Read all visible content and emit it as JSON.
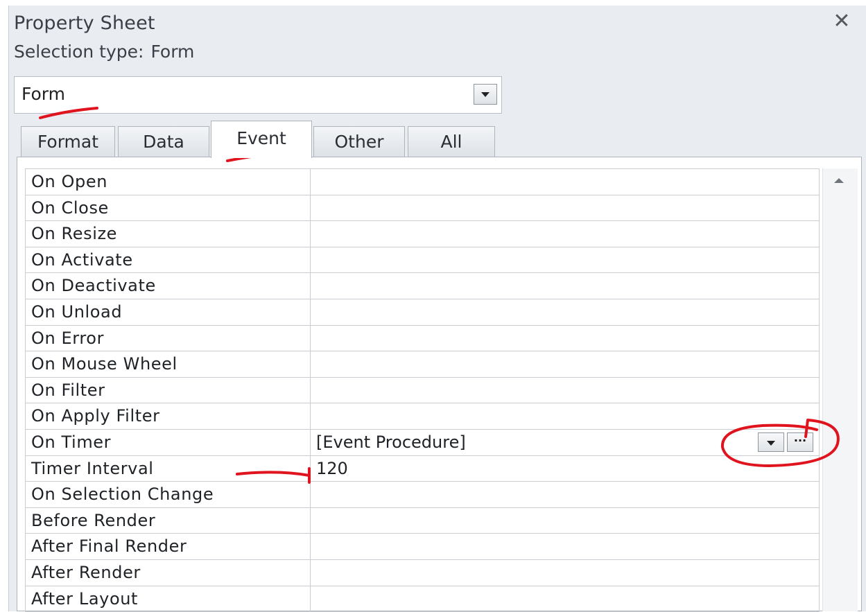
{
  "panel": {
    "title": "Property Sheet",
    "close_label": "✕",
    "selection_type_label": "Selection type:",
    "selection_type_value": "Form"
  },
  "object_selector": {
    "value": "Form"
  },
  "tabs": [
    {
      "label": "Format",
      "active": false
    },
    {
      "label": "Data",
      "active": false
    },
    {
      "label": "Event",
      "active": true
    },
    {
      "label": "Other",
      "active": false
    },
    {
      "label": "All",
      "active": false
    }
  ],
  "properties": [
    {
      "name": "On Open",
      "value": ""
    },
    {
      "name": "On Close",
      "value": ""
    },
    {
      "name": "On Resize",
      "value": ""
    },
    {
      "name": "On Activate",
      "value": ""
    },
    {
      "name": "On Deactivate",
      "value": ""
    },
    {
      "name": "On Unload",
      "value": ""
    },
    {
      "name": "On Error",
      "value": ""
    },
    {
      "name": "On Mouse Wheel",
      "value": ""
    },
    {
      "name": "On Filter",
      "value": ""
    },
    {
      "name": "On Apply Filter",
      "value": ""
    },
    {
      "name": "On Timer",
      "value": "[Event Procedure]"
    },
    {
      "name": "Timer Interval",
      "value": "120"
    },
    {
      "name": "On Selection Change",
      "value": ""
    },
    {
      "name": "Before Render",
      "value": ""
    },
    {
      "name": "After Final Render",
      "value": ""
    },
    {
      "name": "After Render",
      "value": ""
    },
    {
      "name": "After Layout",
      "value": ""
    }
  ],
  "builder_button_label": "···",
  "colors": {
    "panel_bg": "#e9edf2",
    "annotation_red": "#e0141e"
  }
}
